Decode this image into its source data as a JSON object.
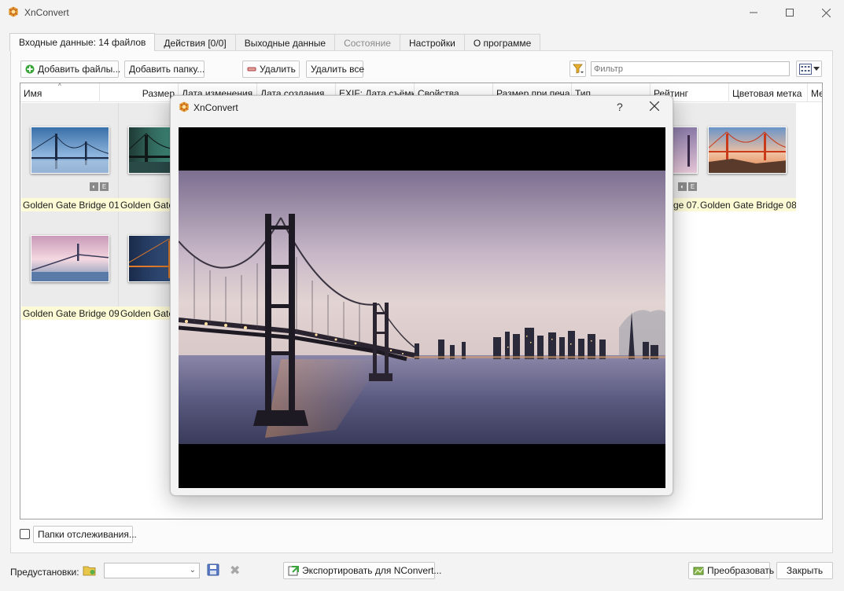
{
  "window": {
    "title": "XnConvert",
    "minimize_icon": "minimize-icon",
    "maximize_icon": "maximize-icon",
    "close_icon": "close-icon"
  },
  "tabs": [
    {
      "label": "Входные данные: 14 файлов",
      "active": true
    },
    {
      "label": "Действия [0/0]"
    },
    {
      "label": "Выходные данные"
    },
    {
      "label": "Состояние",
      "disabled": true
    },
    {
      "label": "Настройки"
    },
    {
      "label": "О программе"
    }
  ],
  "toolbar": {
    "add_files": "Добавить файлы...",
    "add_folder": "Добавить папку...",
    "remove": "Удалить",
    "remove_all": "Удалить все",
    "filter_placeholder": "Фильтр"
  },
  "columns": [
    "Имя",
    "Размер",
    "Дата изменения",
    "Дата создания",
    "EXIF: Дата съёмки",
    "Свойства",
    "Размер при печа",
    "Тип",
    "Рейтинг",
    "Цветовая метка",
    "Ме"
  ],
  "thumbnails": [
    {
      "label": "Golden Gate Bridge 01..."
    },
    {
      "label": "Golden Gate"
    },
    {
      "label": "ge 07..."
    },
    {
      "label": "Golden Gate Bridge 08..."
    },
    {
      "label": "Golden Gate Bridge 09..."
    },
    {
      "label": "Golden Gate"
    }
  ],
  "watch_folders_label": "Папки отслеживания...",
  "bottom": {
    "presets_label": "Предустановки:",
    "export_nconvert": "Экспортировать для NConvert...",
    "convert": "Преобразовать",
    "close": "Закрыть"
  },
  "dialog": {
    "title": "XnConvert",
    "help": "?",
    "close_icon": "close-icon"
  },
  "colors": {
    "label_bg": "#fdfbd6",
    "thumb_cell_bg": "#ebebeb",
    "window_bg": "#f3f3f3"
  }
}
